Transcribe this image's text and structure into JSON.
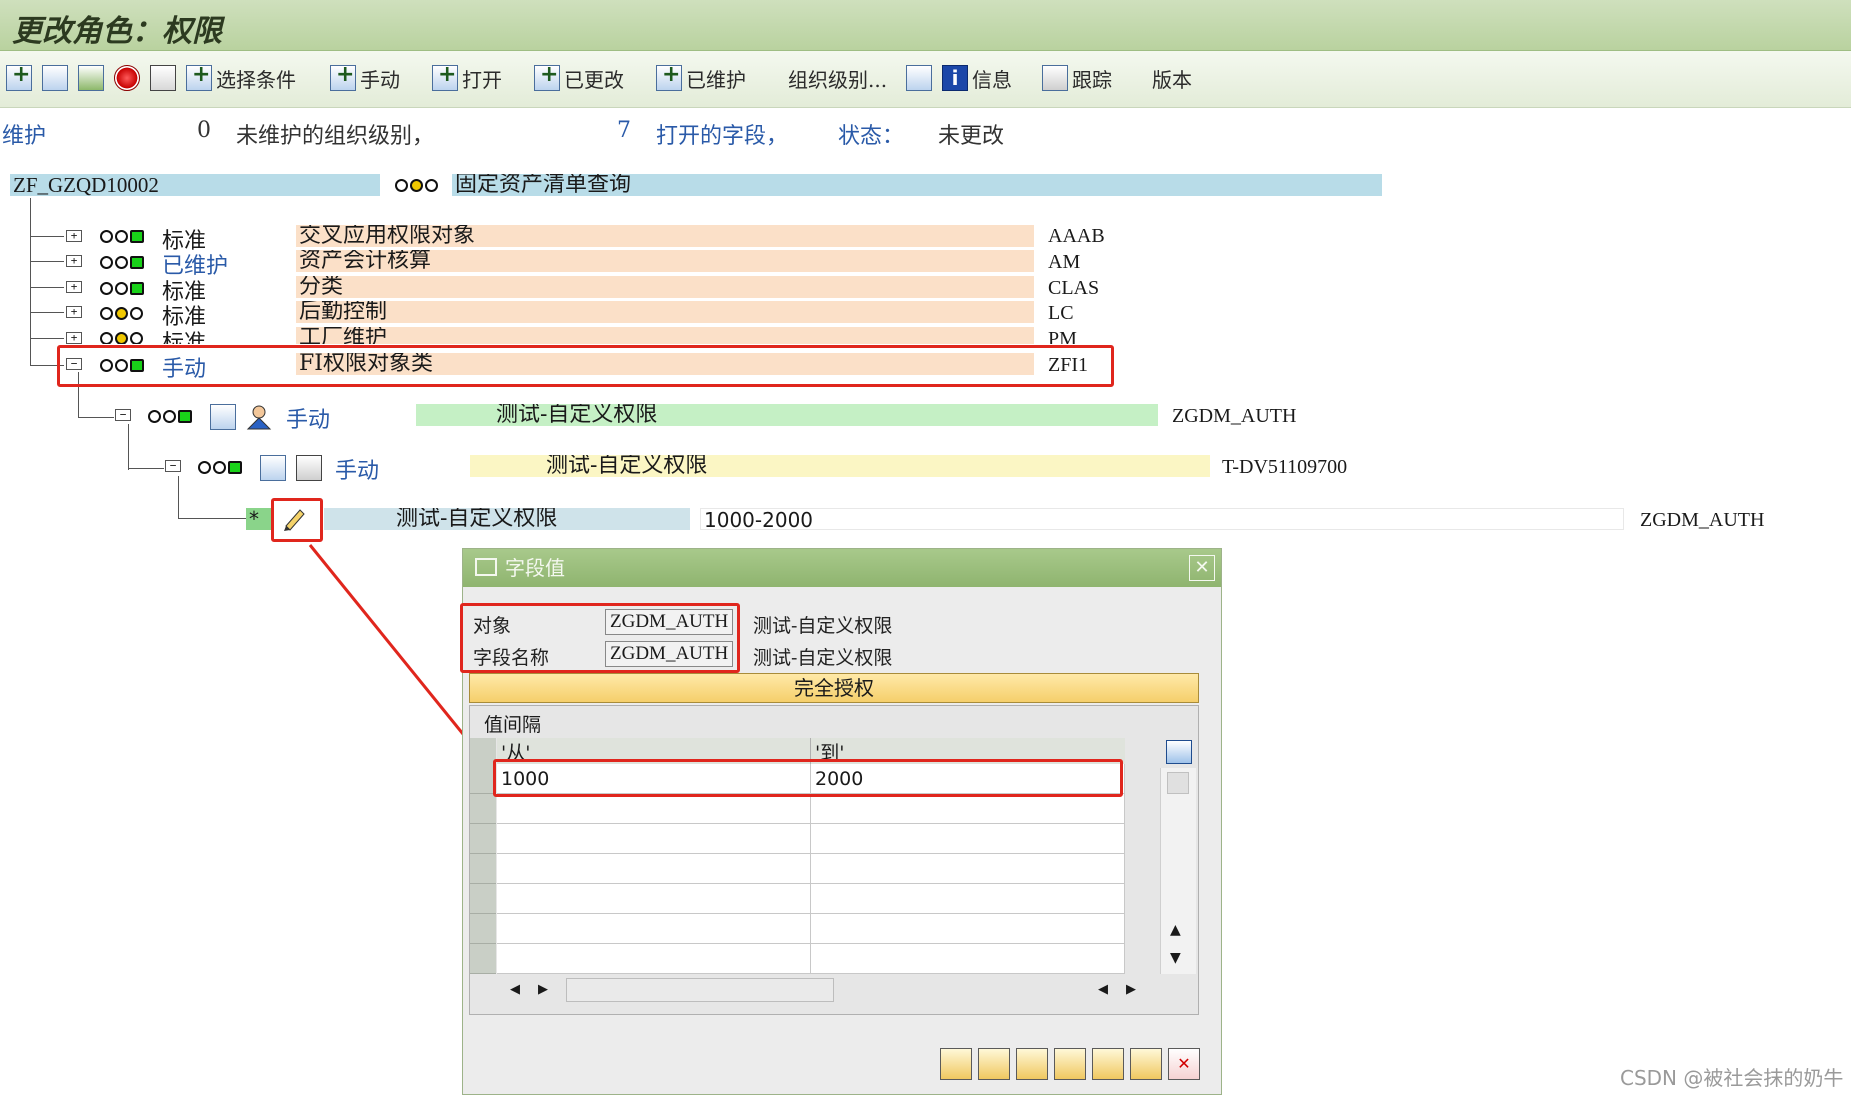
{
  "window": {
    "title": "更改角色：权限"
  },
  "toolbar": {
    "select_criteria": "选择条件",
    "manual": "手动",
    "open": "打开",
    "changed": "已更改",
    "maintained": "已维护",
    "org_levels": "组织级别...",
    "info": "信息",
    "trace": "跟踪",
    "version": "版本"
  },
  "status_line": {
    "maintain": "维护",
    "unmaintained_count": "0",
    "unmaintained_text": "未维护的组织级别，",
    "open_count": "7",
    "open_text": "打开的字段，",
    "status_label": "状态：",
    "status_value": "未更改"
  },
  "role": {
    "name": "ZF_GZQD10002",
    "description": "固定资产清单查询"
  },
  "tree": {
    "rows": [
      {
        "status": "标准",
        "text": "交叉应用权限对象",
        "code": "AAAB"
      },
      {
        "status": "已维护",
        "text": "资产会计核算",
        "code": "AM"
      },
      {
        "status": "标准",
        "text": "分类",
        "code": "CLAS"
      },
      {
        "status": "标准",
        "text": "后勤控制",
        "code": "LC"
      },
      {
        "status": "标准",
        "text": "工厂维护",
        "code": "PM"
      },
      {
        "status": "手动",
        "text": "FI权限对象类",
        "code": "ZFI1"
      }
    ],
    "level2": {
      "status": "手动",
      "text": "测试-自定义权限",
      "code": "ZGDM_AUTH"
    },
    "level3": {
      "status": "手动",
      "text": "测试-自定义权限",
      "code": "T-DV51109700"
    },
    "field": {
      "marker": "*",
      "text": "测试-自定义权限",
      "value": "1000-2000",
      "code": "ZGDM_AUTH"
    }
  },
  "dialog": {
    "title": "字段值",
    "object_label": "对象",
    "object_value": "ZGDM_AUTH",
    "object_desc": "测试-自定义权限",
    "field_label": "字段名称",
    "field_value": "ZGDM_AUTH",
    "field_desc": "测试-自定义权限",
    "full_auth": "完全授权",
    "interval_label": "值间隔",
    "col_from": "'从'",
    "col_to": "'到'",
    "rows": [
      {
        "from": "1000",
        "to": "2000"
      }
    ]
  },
  "watermark": "CSDN @被社会抹的奶牛",
  "colors": {
    "title_bar": "#b9d29f",
    "role_band": "#b8dce8",
    "object_band": "#fbe0c8",
    "green_band": "#c5f0c5",
    "yellow_band": "#fbf6c4",
    "highlight_red": "#e0261d"
  }
}
